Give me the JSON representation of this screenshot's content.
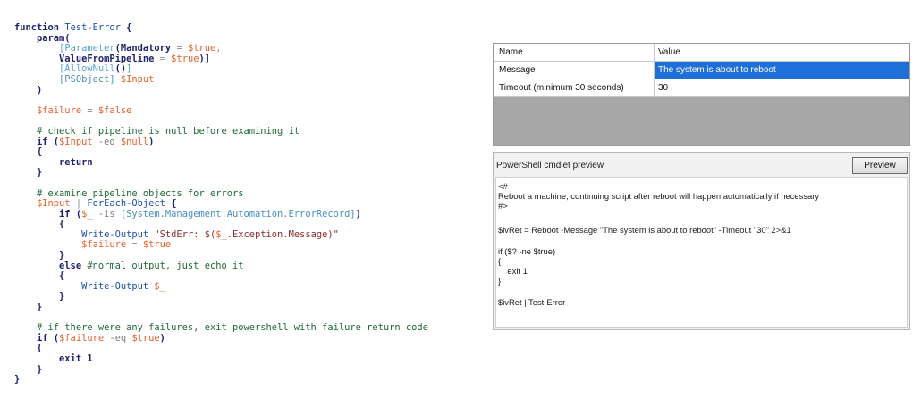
{
  "code": {
    "lines": [
      [
        {
          "t": "function ",
          "c": "kw"
        },
        {
          "t": "Test-Error",
          "c": "cmd"
        },
        {
          "t": " {",
          "c": "kw"
        }
      ],
      [
        {
          "t": "    param(",
          "c": "kw"
        }
      ],
      [
        {
          "t": "        [",
          "c": "attr"
        },
        {
          "t": "Parameter",
          "c": "attr"
        },
        {
          "t": "(Mandatory ",
          "c": "kw"
        },
        {
          "t": "=",
          "c": "op"
        },
        {
          "t": " $true",
          "c": "var"
        },
        {
          "t": ",",
          "c": "op"
        }
      ],
      [
        {
          "t": "        ValueFromPipeline ",
          "c": "kw"
        },
        {
          "t": "=",
          "c": "op"
        },
        {
          "t": " $true",
          "c": "var"
        },
        {
          "t": ")]",
          "c": "kw"
        }
      ],
      [
        {
          "t": "        [AllowNull",
          "c": "attr"
        },
        {
          "t": "()",
          "c": "kw"
        },
        {
          "t": "]",
          "c": "attr"
        }
      ],
      [
        {
          "t": "        [PSObject]",
          "c": "type"
        },
        {
          "t": " $Input",
          "c": "var"
        }
      ],
      [
        {
          "t": "    )",
          "c": "kw"
        }
      ],
      [],
      [
        {
          "t": "    $failure",
          "c": "var"
        },
        {
          "t": " = ",
          "c": "op"
        },
        {
          "t": "$false",
          "c": "var"
        }
      ],
      [],
      [
        {
          "t": "    # check if pipeline is null before examining it",
          "c": "cm"
        }
      ],
      [
        {
          "t": "    if (",
          "c": "kw"
        },
        {
          "t": "$Input",
          "c": "var"
        },
        {
          "t": " -eq ",
          "c": "prm"
        },
        {
          "t": "$null",
          "c": "var"
        },
        {
          "t": ")",
          "c": "kw"
        }
      ],
      [
        {
          "t": "    {",
          "c": "kw"
        }
      ],
      [
        {
          "t": "        return",
          "c": "kw"
        }
      ],
      [
        {
          "t": "    }",
          "c": "kw"
        }
      ],
      [],
      [
        {
          "t": "    # examine pipeline objects for errors",
          "c": "cm"
        }
      ],
      [
        {
          "t": "    $Input",
          "c": "var"
        },
        {
          "t": " | ",
          "c": "op"
        },
        {
          "t": "ForEach-Object",
          "c": "cmd"
        },
        {
          "t": " {",
          "c": "kw"
        }
      ],
      [
        {
          "t": "        if (",
          "c": "kw"
        },
        {
          "t": "$_",
          "c": "var"
        },
        {
          "t": " -is ",
          "c": "prm"
        },
        {
          "t": "[System.Management.Automation.ErrorRecord]",
          "c": "type"
        },
        {
          "t": ")",
          "c": "kw"
        }
      ],
      [
        {
          "t": "        {",
          "c": "kw"
        }
      ],
      [
        {
          "t": "            Write-Output ",
          "c": "cmd"
        },
        {
          "t": "\"StdErr: $(",
          "c": "str"
        },
        {
          "t": "$_",
          "c": "var"
        },
        {
          "t": ".Exception.Message)\"",
          "c": "str"
        }
      ],
      [
        {
          "t": "            $failure",
          "c": "var"
        },
        {
          "t": " = ",
          "c": "op"
        },
        {
          "t": "$true",
          "c": "var"
        }
      ],
      [
        {
          "t": "        }",
          "c": "kw"
        }
      ],
      [
        {
          "t": "        else ",
          "c": "kw"
        },
        {
          "t": "#normal output, just echo it",
          "c": "cm"
        }
      ],
      [
        {
          "t": "        {",
          "c": "kw"
        }
      ],
      [
        {
          "t": "            Write-Output ",
          "c": "cmd"
        },
        {
          "t": "$_",
          "c": "var"
        }
      ],
      [
        {
          "t": "        }",
          "c": "kw"
        }
      ],
      [
        {
          "t": "    }",
          "c": "kw"
        }
      ],
      [],
      [
        {
          "t": "    # if there were any failures, exit powershell with failure return code",
          "c": "cm"
        }
      ],
      [
        {
          "t": "    if (",
          "c": "kw"
        },
        {
          "t": "$failure",
          "c": "var"
        },
        {
          "t": " -eq ",
          "c": "prm"
        },
        {
          "t": "$true",
          "c": "var"
        },
        {
          "t": ")",
          "c": "kw"
        }
      ],
      [
        {
          "t": "    {",
          "c": "kw"
        }
      ],
      [
        {
          "t": "        exit 1",
          "c": "kw"
        }
      ],
      [
        {
          "t": "    }",
          "c": "kw"
        }
      ],
      [
        {
          "t": "}",
          "c": "kw"
        }
      ]
    ]
  },
  "grid": {
    "headers": {
      "name": "Name",
      "value": "Value"
    },
    "rows": [
      {
        "name": "Message",
        "value": "The system is about to reboot"
      },
      {
        "name": "Timeout (minimum 30 seconds)",
        "value": "30"
      }
    ],
    "selected_color": "#1f6fd9"
  },
  "preview": {
    "label": "PowerShell cmdlet preview",
    "button": "Preview",
    "lines": [
      "<#",
      "Reboot a machine, continuing script after reboot will happen automatically if necessary",
      "#>",
      "",
      "$ivRet = Reboot -Message \"The system is about to reboot\" -Timeout \"30\" 2>&1",
      "",
      "if ($? -ne $true)",
      "{",
      "    exit 1",
      "}",
      "",
      "$ivRet | Test-Error"
    ]
  }
}
